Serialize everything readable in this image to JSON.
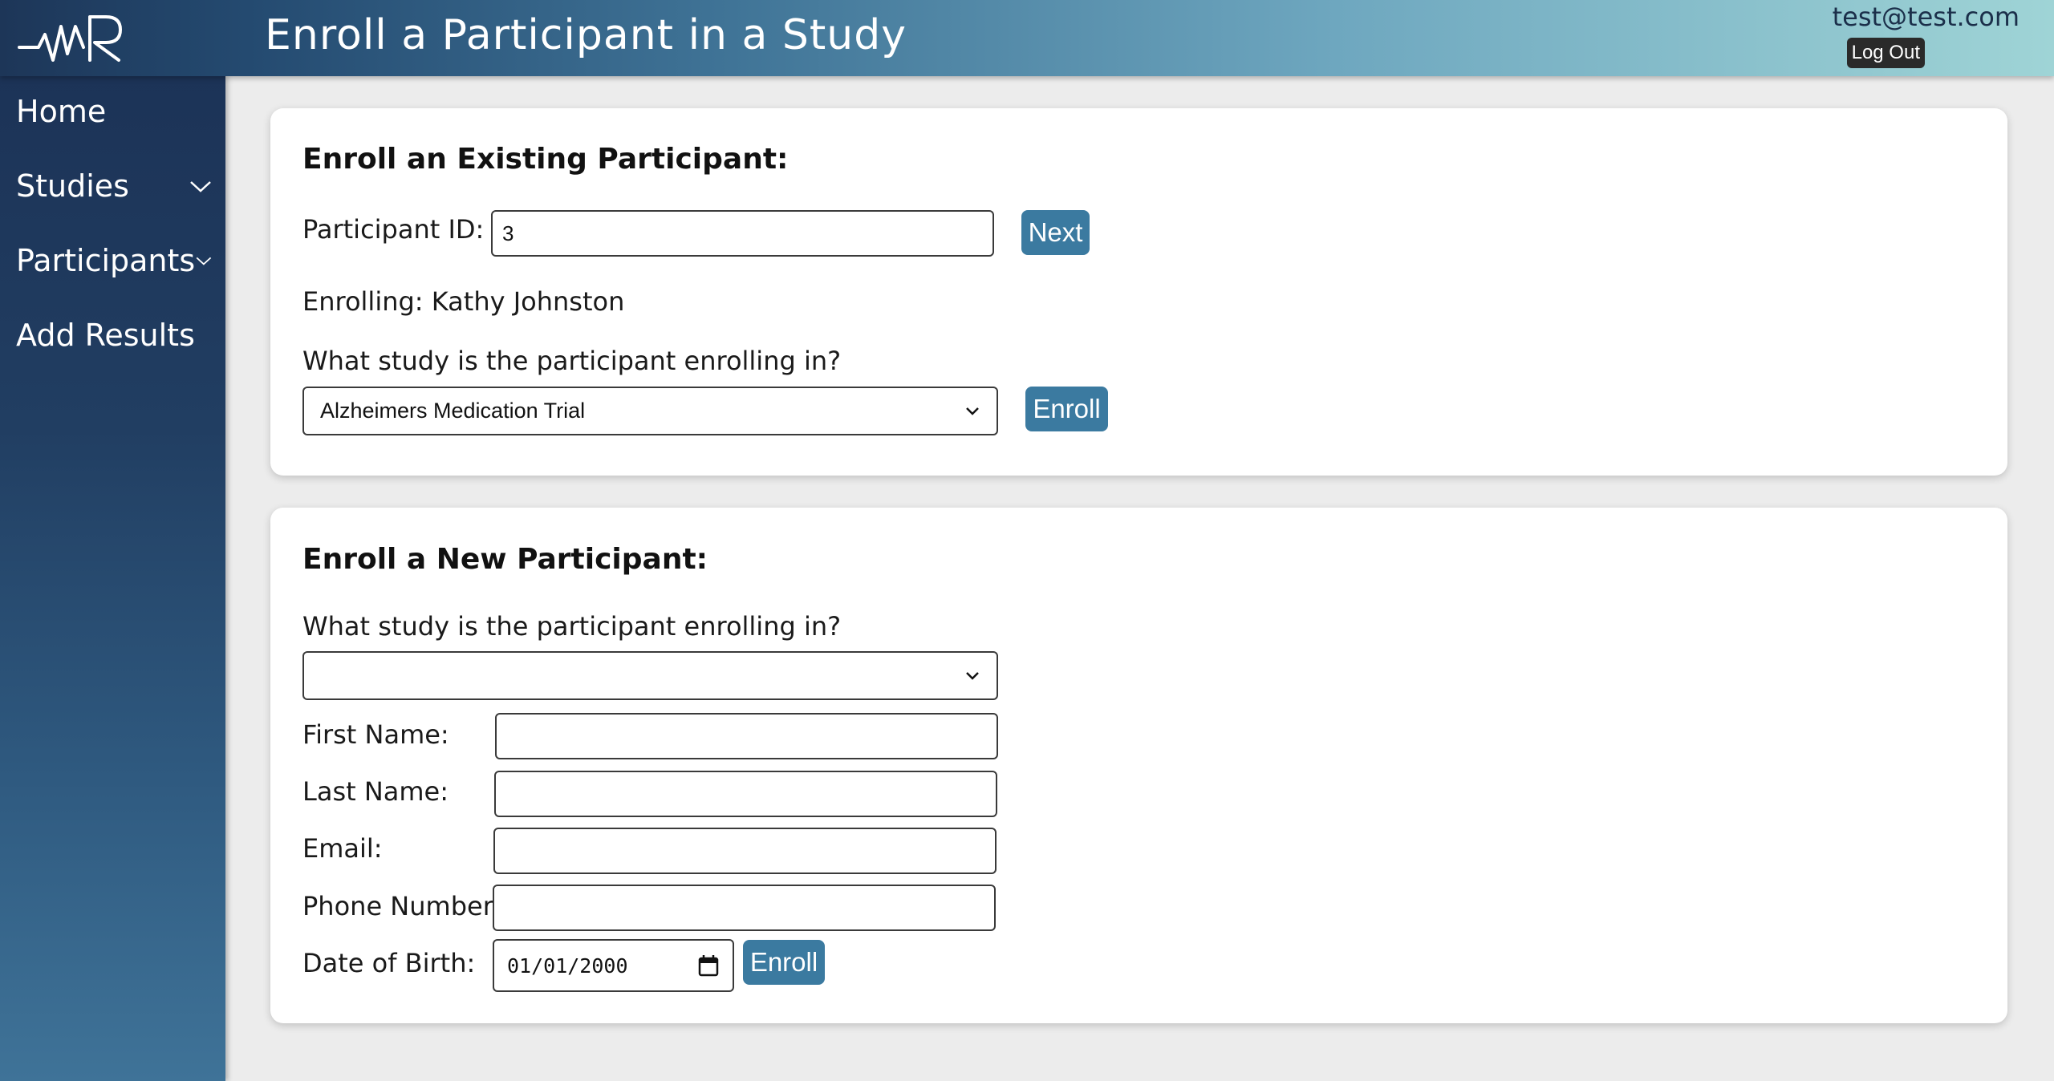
{
  "header": {
    "title": "Enroll a Participant in a Study",
    "user_email": "test@test.com",
    "logout_label": "Log Out",
    "logo_text": "WR"
  },
  "sidebar": {
    "items": [
      {
        "label": "Home",
        "has_dropdown": false
      },
      {
        "label": "Studies",
        "has_dropdown": true
      },
      {
        "label": "Participants",
        "has_dropdown": true
      },
      {
        "label": "Add Results",
        "has_dropdown": false
      }
    ]
  },
  "existing": {
    "title": "Enroll an Existing Participant:",
    "participant_id_label": "Participant ID:",
    "participant_id_value": "3",
    "next_label": "Next",
    "enrolling_text": "Enrolling: Kathy Johnston",
    "study_question": "What study is the participant enrolling in?",
    "study_selected": "Alzheimers Medication Trial",
    "enroll_label": "Enroll"
  },
  "new": {
    "title": "Enroll a New Participant:",
    "study_question": "What study is the participant enrolling in?",
    "study_selected": "",
    "first_name_label": "First Name:",
    "first_name_value": "",
    "last_name_label": "Last Name:",
    "last_name_value": "",
    "email_label": "Email:",
    "email_value": "",
    "phone_label": "Phone Number:",
    "phone_value": "",
    "dob_label": "Date of Birth:",
    "dob_value": "01/01/2000",
    "enroll_label": "Enroll"
  },
  "colors": {
    "accent_button": "#3b7aa0",
    "sidebar_top": "#1c3357",
    "header_right": "#9fd4d6"
  }
}
